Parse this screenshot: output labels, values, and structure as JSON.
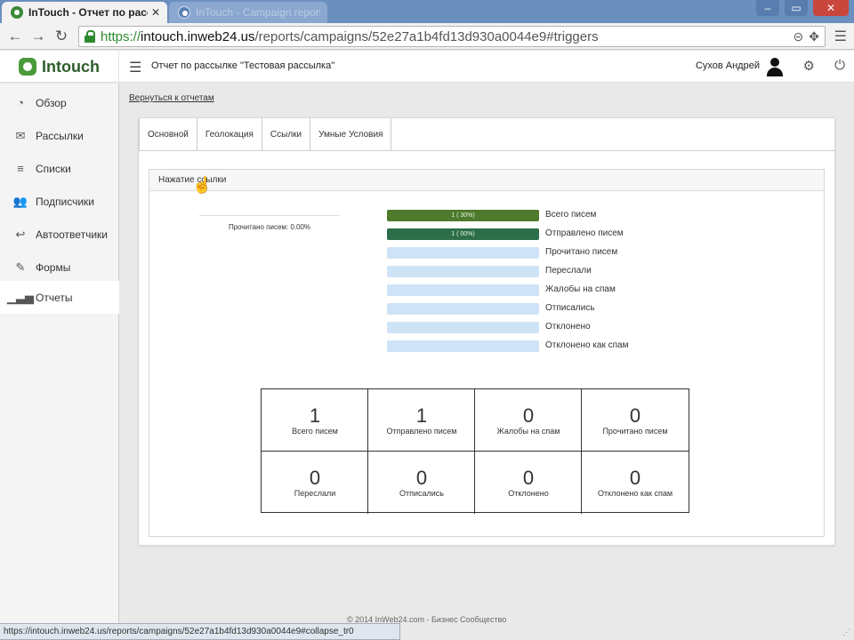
{
  "browser": {
    "tabs": [
      {
        "title": "InTouch - Отчет по рассы",
        "active": true
      },
      {
        "title": "InTouch - Campaign report",
        "active": false
      }
    ],
    "url": {
      "scheme": "https://",
      "host": "intouch.inweb24.us",
      "path": "/reports/campaigns/52e27a1b4fd13d930a0044e9#triggers"
    },
    "status_url": "https://intouch.inweb24.us/reports/campaigns/52e27a1b4fd13d930a0044e9#collapse_tr0"
  },
  "header": {
    "logo": "Intouch",
    "page_title": "Отчет по рассылке \"Тестовая рассылка\"",
    "user_name": "Сухов Андрей"
  },
  "sidebar": {
    "items": [
      {
        "label": "Обзор",
        "icon": "dashboard-icon"
      },
      {
        "label": "Рассылки",
        "icon": "envelope-icon"
      },
      {
        "label": "Списки",
        "icon": "list-icon"
      },
      {
        "label": "Подписчики",
        "icon": "users-icon"
      },
      {
        "label": "Автоответчики",
        "icon": "reply-icon"
      },
      {
        "label": "Формы",
        "icon": "magic-wand-icon"
      },
      {
        "label": "Отчеты",
        "icon": "signal-icon",
        "active": true
      }
    ]
  },
  "main": {
    "back_link": "Вернуться к отчетам",
    "tabs": [
      "Основной",
      "Геолокация",
      "Ссылки",
      "Умные Условия"
    ],
    "section_title": "Нажатие ссылки",
    "read_caption": "Прочитано писем: 0.00%",
    "bars": [
      {
        "label": "Всего писем",
        "fill_pct": 100,
        "text": "1 ( 30%)",
        "style": "olive"
      },
      {
        "label": "Отправлено писем",
        "fill_pct": 100,
        "text": "1 ( 00%)",
        "style": "teal"
      },
      {
        "label": "Прочитано писем",
        "fill_pct": 0,
        "text": "",
        "style": ""
      },
      {
        "label": "Переслали",
        "fill_pct": 0,
        "text": "",
        "style": ""
      },
      {
        "label": "Жалобы на спам",
        "fill_pct": 0,
        "text": "",
        "style": ""
      },
      {
        "label": "Отписались",
        "fill_pct": 0,
        "text": "",
        "style": ""
      },
      {
        "label": "Отклонено",
        "fill_pct": 0,
        "text": "",
        "style": ""
      },
      {
        "label": "Отклонено как спам",
        "fill_pct": 0,
        "text": "",
        "style": ""
      }
    ],
    "stats": [
      {
        "value": "1",
        "label": "Всего писем"
      },
      {
        "value": "1",
        "label": "Отправлено писем"
      },
      {
        "value": "0",
        "label": "Жалобы на спам"
      },
      {
        "value": "0",
        "label": "Прочитано писем"
      },
      {
        "value": "0",
        "label": "Переслали"
      },
      {
        "value": "0",
        "label": "Отписались"
      },
      {
        "value": "0",
        "label": "Отклонено"
      },
      {
        "value": "0",
        "label": "Отклонено как спам"
      }
    ]
  },
  "footer": {
    "text": "© 2014 InWeb24.com - Бизнес Сообщество"
  },
  "colors": {
    "bar_olive": "#4e7a2c",
    "bar_teal": "#2d6e4a",
    "bar_empty": "#cfe3f7",
    "logo_green": "#4a9a3a"
  }
}
